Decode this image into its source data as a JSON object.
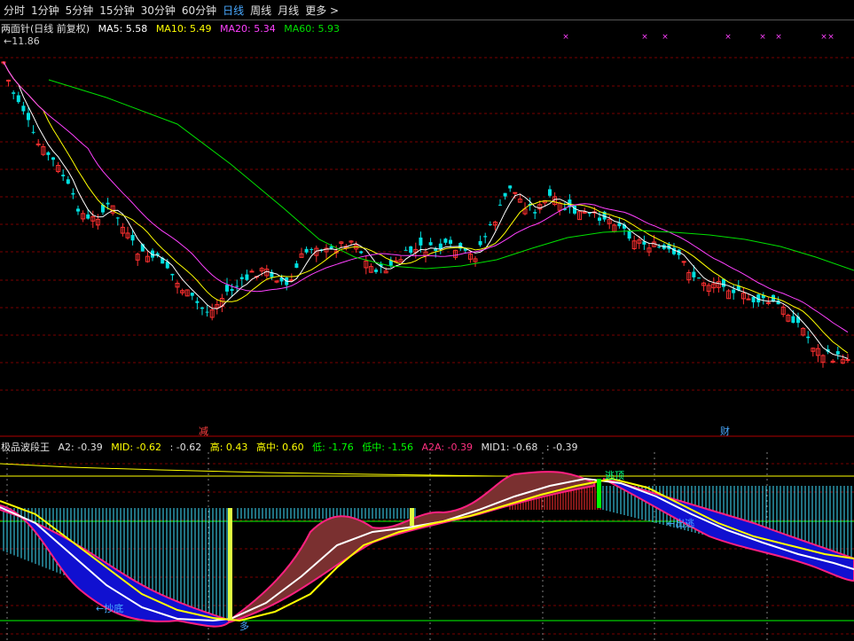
{
  "toolbar": {
    "tabs": [
      "分时",
      "1分钟",
      "5分钟",
      "15分钟",
      "30分钟",
      "60分钟",
      "日线",
      "周线",
      "月线",
      "更多 >"
    ],
    "active_index": 6
  },
  "main_chart": {
    "title": "两面针(日线 前复权)",
    "ma": [
      {
        "label": "MA5: 5.58",
        "color": "#ffffff"
      },
      {
        "label": "MA10: 5.49",
        "color": "#ffff00"
      },
      {
        "label": "MA20: 5.34",
        "color": "#ff40ff"
      },
      {
        "label": "MA60: 5.93",
        "color": "#00e000"
      }
    ],
    "max_price": "11.86",
    "events": [
      "减",
      "财"
    ]
  },
  "indicator": {
    "name": "极品波段王",
    "values": [
      {
        "label": "A2: -0.39",
        "color": "#e0e0e0"
      },
      {
        "label": "MID: -0.62",
        "color": "#ffff00"
      },
      {
        "label": ": -0.62",
        "color": "#e0e0e0"
      },
      {
        "label": "高: 0.43",
        "color": "#ffff00"
      },
      {
        "label": "高中: 0.60",
        "color": "#ffff00"
      },
      {
        "label": "低: -1.76",
        "color": "#00ff00"
      },
      {
        "label": "低中: -1.56",
        "color": "#00ff00"
      },
      {
        "label": "A2A: -0.39",
        "color": "#ff3080"
      },
      {
        "label": "MID1: -0.68",
        "color": "#e0e0e0"
      },
      {
        "label": ": -0.39",
        "color": "#e0e0e0"
      }
    ],
    "signals": [
      "←抄底",
      "多",
      "逃顶",
      "←出逃"
    ]
  },
  "colors": {
    "up": "#ff3030",
    "down": "#00e0e0",
    "grid": "#7a0000",
    "ma5": "#ffffff",
    "ma10": "#ffff00",
    "ma20": "#ff40ff",
    "ma60": "#00e000"
  }
}
